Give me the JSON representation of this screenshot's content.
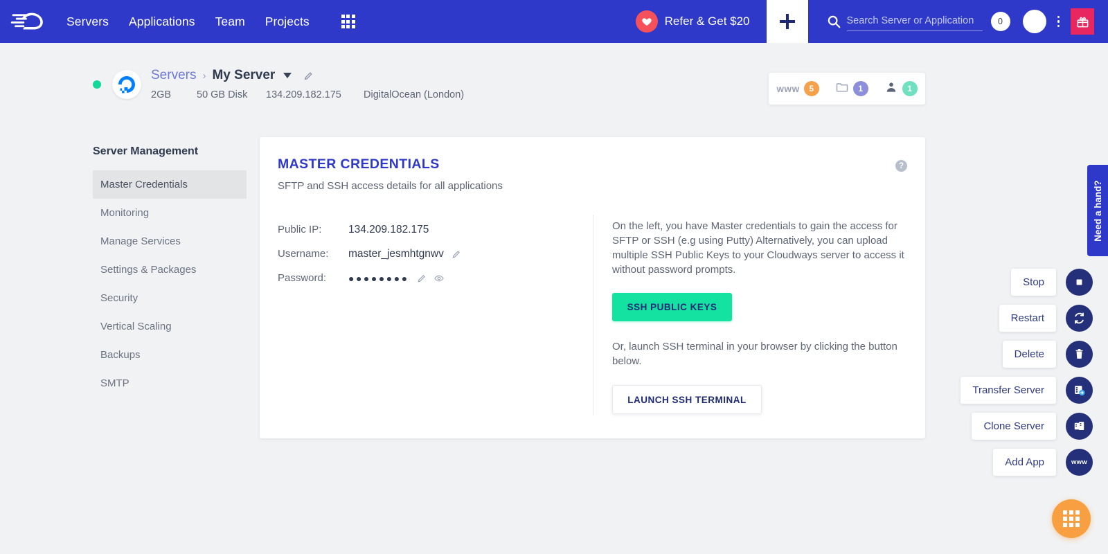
{
  "topnav": {
    "logo_icon": "cloudways-cloud-logo",
    "links": [
      {
        "label": "Servers"
      },
      {
        "label": "Applications"
      },
      {
        "label": "Team"
      },
      {
        "label": "Projects"
      }
    ],
    "grid_icon": "grid-apps-icon",
    "refer": {
      "label": "Refer & Get $20",
      "icon": "heart-icon",
      "color": "#f4515b"
    },
    "plus_icon": "plus-icon",
    "search": {
      "placeholder": "Search Server or Application",
      "value": "",
      "icon": "search-icon"
    },
    "notification_count": "0",
    "avatar_icon": "avatar-icon",
    "kebab_icon": "kebab-menu-icon",
    "gift_icon": "gift-icon",
    "gift_color": "#e8265f",
    "background_color": "#2f39c9"
  },
  "server_header": {
    "status": "online",
    "status_color": "#16d79a",
    "provider_icon": "digitalocean-logo",
    "breadcrumb_parent": "Servers",
    "breadcrumb_sep": "›",
    "server_name": "My Server",
    "caret_icon": "chevron-down-icon",
    "edit_icon": "pencil-icon",
    "specs": {
      "ram": "2GB",
      "disk": "50 GB Disk",
      "ip": "134.209.182.175",
      "provider": "DigitalOcean (London)"
    }
  },
  "counters": [
    {
      "icon": "www-icon",
      "label": "www",
      "count": "5",
      "color": "#f5a04a"
    },
    {
      "icon": "folder-icon",
      "label": "",
      "count": "1",
      "color": "#8b8fdc"
    },
    {
      "icon": "user-icon",
      "label": "",
      "count": "1",
      "color": "#6fe0c0"
    }
  ],
  "sidebar": {
    "title": "Server Management",
    "items": [
      {
        "label": "Master Credentials",
        "active": true
      },
      {
        "label": "Monitoring",
        "active": false
      },
      {
        "label": "Manage Services",
        "active": false
      },
      {
        "label": "Settings & Packages",
        "active": false
      },
      {
        "label": "Security",
        "active": false
      },
      {
        "label": "Vertical Scaling",
        "active": false
      },
      {
        "label": "Backups",
        "active": false
      },
      {
        "label": "SMTP",
        "active": false
      }
    ]
  },
  "card": {
    "title": "MASTER CREDENTIALS",
    "title_color": "#2f39c9",
    "subtitle": "SFTP and SSH access details for all applications",
    "help_icon": "question-mark-icon",
    "credentials": [
      {
        "label": "Public IP:",
        "value": "134.209.182.175",
        "icons": []
      },
      {
        "label": "Username:",
        "value": "master_jesmhtgnwv",
        "icons": [
          "pencil-icon"
        ]
      },
      {
        "label": "Password:",
        "value": "●●●●●●●●",
        "icons": [
          "pencil-icon",
          "eye-icon"
        ]
      }
    ],
    "info_paragraph": "On the left, you have Master credentials to gain the access for SFTP or SSH (e.g using Putty) Alternatively, you can upload multiple SSH Public Keys to your Cloudways server to access it without password prompts.",
    "ssh_keys_button": "SSH PUBLIC KEYS",
    "ssh_keys_color": "#14e2a0",
    "info_paragraph2": "Or, launch SSH terminal in your browser by clicking the button below.",
    "launch_terminal_button": "LAUNCH SSH TERMINAL"
  },
  "actions": [
    {
      "label": "Stop",
      "icon": "stop-square-icon"
    },
    {
      "label": "Restart",
      "icon": "restart-refresh-icon"
    },
    {
      "label": "Delete",
      "icon": "trash-icon"
    },
    {
      "label": "Transfer Server",
      "icon": "transfer-server-icon"
    },
    {
      "label": "Clone Server",
      "icon": "clone-server-icon"
    },
    {
      "label": "Add App",
      "icon": "www-icon"
    }
  ],
  "help_tab": {
    "label": "Need a hand?",
    "color": "#2f39c9"
  },
  "fab": {
    "icon": "grid-apps-icon",
    "color": "#f79f41"
  }
}
